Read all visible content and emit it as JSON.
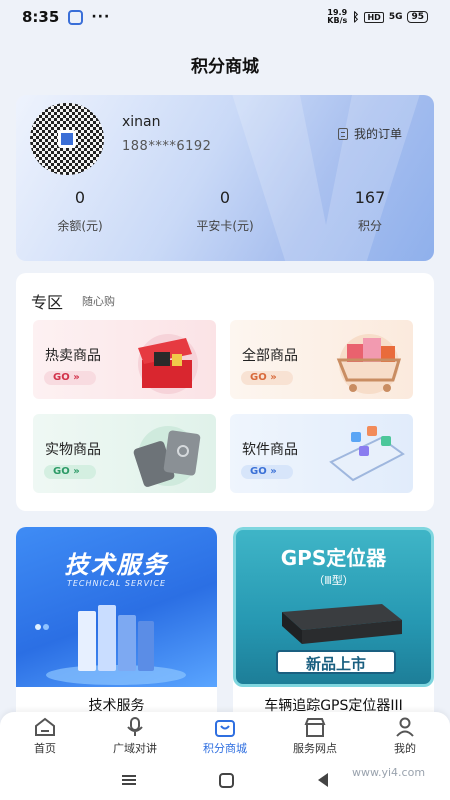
{
  "status": {
    "time": "8:35",
    "net_speed_value": "19.9",
    "net_speed_unit": "KB/s",
    "hd": "HD",
    "signal": "5G",
    "battery": "95"
  },
  "page_title": "积分商城",
  "user": {
    "name": "xinan",
    "phone": "188****6192",
    "orders_label": "我的订单",
    "stats": [
      {
        "value": "0",
        "label": "余额(元)"
      },
      {
        "value": "0",
        "label": "平安卡(元)"
      },
      {
        "value": "167",
        "label": "积分"
      }
    ]
  },
  "zone": {
    "title": "专区",
    "subtitle": "随心购",
    "go_label": "GO »",
    "tiles": [
      {
        "label": "热卖商品"
      },
      {
        "label": "全部商品"
      },
      {
        "label": "实物商品"
      },
      {
        "label": "软件商品"
      }
    ]
  },
  "promos": [
    {
      "banner_title": "技术服务",
      "banner_subtitle": "TECHNICAL SERVICE",
      "caption": "技术服务"
    },
    {
      "banner_title": "GPS定位器",
      "banner_model": "（Ⅲ型）",
      "banner_tag": "新品上市",
      "caption": "车辆追踪GPS定位器III"
    }
  ],
  "tabs": [
    {
      "label": "首页",
      "icon": "home-icon",
      "active": false
    },
    {
      "label": "广域对讲",
      "icon": "microphone-icon",
      "active": false
    },
    {
      "label": "积分商城",
      "icon": "shopping-bag-icon",
      "active": true
    },
    {
      "label": "服务网点",
      "icon": "store-icon",
      "active": false
    },
    {
      "label": "我的",
      "icon": "user-icon",
      "active": false
    }
  ],
  "watermark": "www.yi4.com",
  "colors": {
    "accent": "#2f6fe0",
    "hot": "#d2324a",
    "all": "#d8693a",
    "physical": "#2c9a66",
    "software": "#3a70d6"
  }
}
